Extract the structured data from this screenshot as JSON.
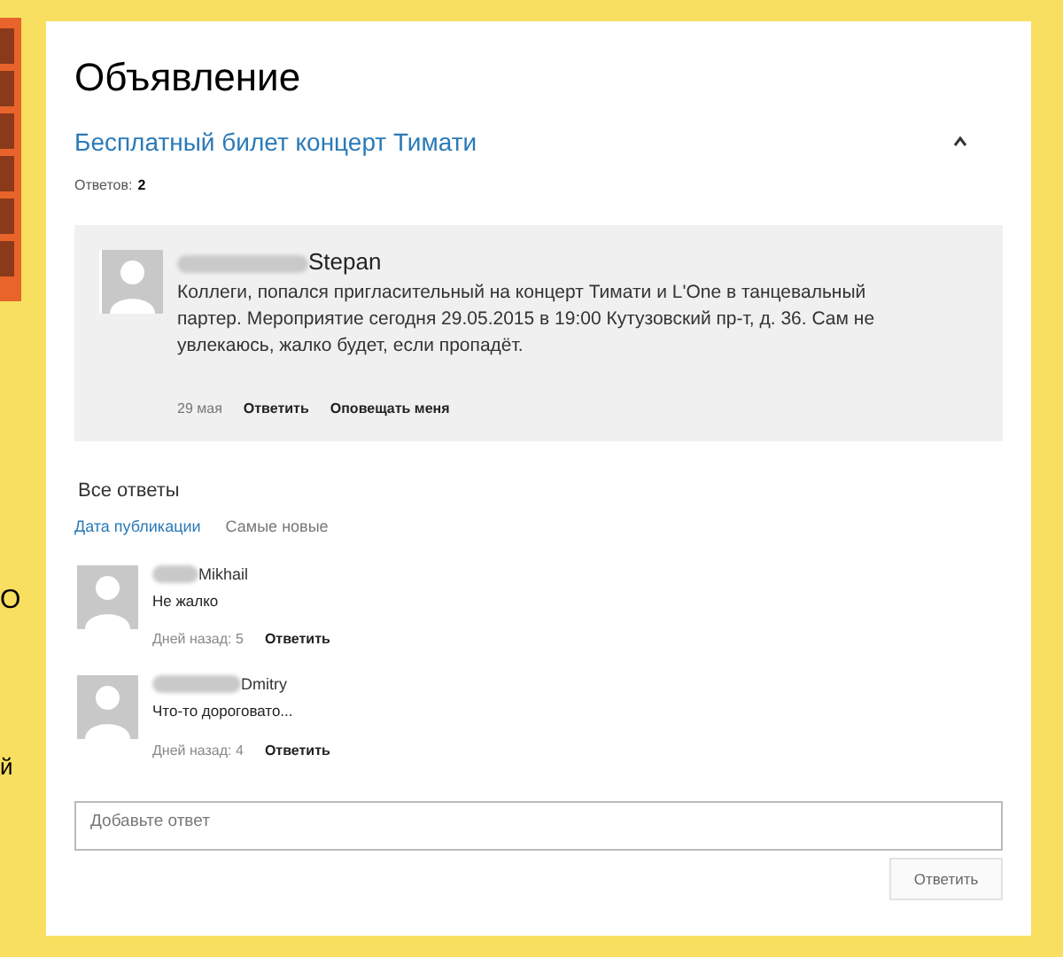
{
  "side_fragments": [
    "О",
    "й"
  ],
  "heading": "Объявление",
  "topic": {
    "title": "Бесплатный билет концерт Тимати",
    "answers_label": "Ответов:",
    "answers_count": "2"
  },
  "post": {
    "author": "Stepan",
    "text": "Коллеги, попался пригласительный на концерт Тимати и L'One в танцевальный партер. Мероприятие сегодня 29.05.2015 в 19:00 Кутузовский пр-т, д. 36. Сам не увлекаюсь, жалко будет, если пропадёт.",
    "date": "29 мая",
    "actions": [
      "Ответить",
      "Оповещать меня"
    ]
  },
  "replies_title": "Все ответы",
  "sort_tabs": [
    {
      "label": "Дата публикации",
      "selected": true
    },
    {
      "label": "Самые новые",
      "selected": false
    }
  ],
  "replies": [
    {
      "author": "Mikhail",
      "text": "Не жалко",
      "age": "Дней назад: 5",
      "action": "Ответить"
    },
    {
      "author": "Dmitry",
      "text": "Что-то дороговато...",
      "age": "Дней назад: 4",
      "action": "Ответить"
    }
  ],
  "reply_field": {
    "placeholder": "Добавьте ответ"
  },
  "submit": "Ответить"
}
